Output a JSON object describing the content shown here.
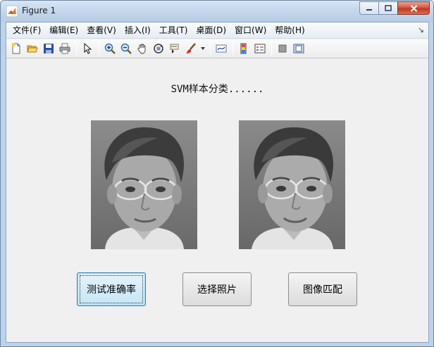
{
  "window": {
    "title": "Figure 1",
    "controls": {
      "minimize": "—",
      "maximize": "▫",
      "close": "✕"
    }
  },
  "menubar": {
    "items": [
      "文件(F)",
      "编辑(E)",
      "查看(V)",
      "插入(I)",
      "工具(T)",
      "桌面(D)",
      "窗口(W)",
      "帮助(H)"
    ],
    "overflow_arrow": "↘"
  },
  "toolbar": {
    "icons": [
      "new-figure-icon",
      "open-file-icon",
      "save-icon",
      "print-icon",
      "edit-plot-icon",
      "zoom-in-icon",
      "zoom-out-icon",
      "pan-icon",
      "rotate-3d-icon",
      "data-cursor-icon",
      "brush-icon",
      "link-plot-icon",
      "colorbar-icon",
      "legend-icon",
      "hide-plot-tools-icon",
      "show-plot-tools-icon"
    ]
  },
  "figure": {
    "caption": "SVM样本分类......",
    "images": [
      {
        "description": "face-image",
        "position": "left"
      },
      {
        "description": "face-image",
        "position": "right"
      }
    ],
    "buttons": {
      "test_accuracy": "测试准确率",
      "select_photo": "选择照片",
      "image_match": "图像匹配"
    }
  },
  "colors": {
    "window_frame": "#bcd3ea",
    "client_bg": "#f0f0f0",
    "focused_button": "#c4e5f6"
  }
}
